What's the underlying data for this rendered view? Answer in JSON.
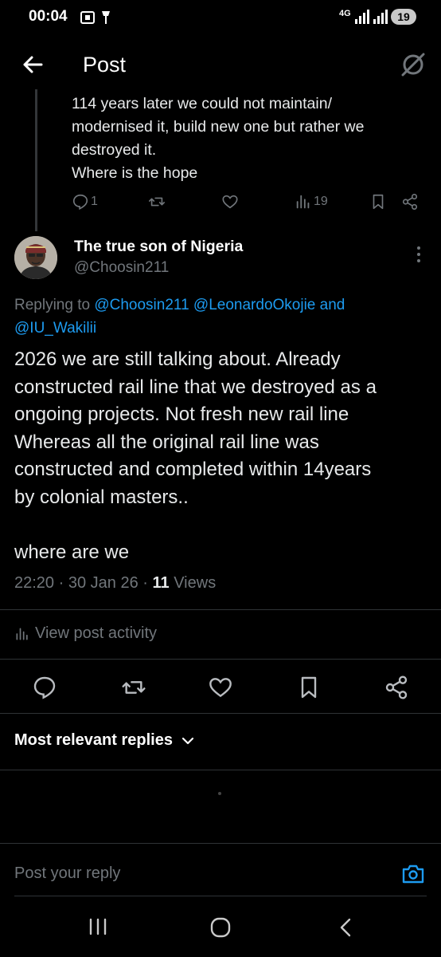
{
  "status_bar": {
    "time": "00:04",
    "network": "4G",
    "battery": "19"
  },
  "header": {
    "title": "Post",
    "back_icon": "arrow-left-icon",
    "grok_icon": "grok-icon"
  },
  "parent_post": {
    "lines": [
      "114 years later we could not maintain/",
      "modernised it, build new one but rather we",
      "destroyed it.",
      "Where is the hope"
    ],
    "reply_count": "1",
    "views": "19"
  },
  "post": {
    "author_name": "The true son of Nigeria",
    "author_handle": "@Choosin211",
    "replying_prefix": "Replying to",
    "mention_1": "@Choosin211",
    "mention_2": "@LeonardoOkojie",
    "mention_and": "and",
    "mention_3": "@IU_Wakilii",
    "body_lines": [
      "2026 we are still talking about. Already",
      "constructed rail line that we destroyed as a",
      "ongoing projects. Not fresh new rail line",
      "Whereas all the original rail line was",
      "constructed and completed within 14years",
      "by colonial masters..",
      "",
      "where are we"
    ],
    "time": "22:20",
    "date": "30 Jan 26",
    "views_count": "11",
    "views_label": "Views"
  },
  "activity_label": "View post activity",
  "replies_sort_label": "Most relevant replies",
  "reply_placeholder": "Post your reply",
  "colors": {
    "accent": "#1d9bf0",
    "muted": "#71767b",
    "text": "#e7e9ea",
    "background": "#000000"
  }
}
